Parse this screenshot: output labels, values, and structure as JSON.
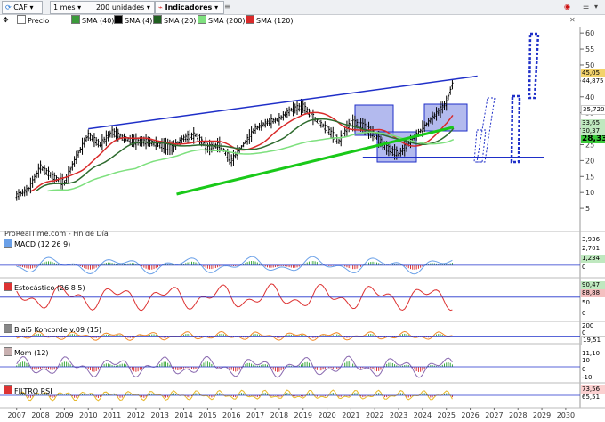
{
  "toolbar": {
    "symbol": "CAF",
    "interval": "1 mes",
    "units": "200 unidades",
    "indicators": "Indicadores"
  },
  "price_legend": [
    {
      "label": "Precio",
      "color": "#ffffff"
    },
    {
      "label": "SMA (40)",
      "color": "#3a9a3a"
    },
    {
      "label": "SMA (4)",
      "color": "#000000"
    },
    {
      "label": "SMA (20)",
      "color": "#1f5f1f"
    },
    {
      "label": "SMA (200)",
      "color": "#7ee07e"
    },
    {
      "label": "SMA (120)",
      "color": "#d92a2a"
    }
  ],
  "watermark": "ProRealTime.com - Fin de Día",
  "price_axis": {
    "ticks": [
      "60",
      "55",
      "50",
      "45",
      "40",
      "35",
      "30",
      "25",
      "20",
      "15",
      "10",
      "5"
    ]
  },
  "price_tags": [
    {
      "value": "45,05",
      "value2": "44,875",
      "color": "#f3d36b"
    },
    {
      "value": "35,720",
      "color": "#ffffff"
    },
    {
      "value": "33,65",
      "color": "#bfe8bf"
    },
    {
      "value": "30,37",
      "color": "#bfe8bf"
    },
    {
      "value": "28,33",
      "color": "#3ccc3c"
    }
  ],
  "x_axis": {
    "years": [
      "2007",
      "2008",
      "2009",
      "2010",
      "2011",
      "2012",
      "2013",
      "2014",
      "2015",
      "2016",
      "2017",
      "2018",
      "2019",
      "2020",
      "2021",
      "2022",
      "2023",
      "2024",
      "2025",
      "2026",
      "2027",
      "2028",
      "2029",
      "2030"
    ]
  },
  "panels": {
    "macd": {
      "title": "MACD (12 26 9)",
      "ticks": [
        "3,936",
        "2,701",
        "1,234",
        "0"
      ]
    },
    "stoch": {
      "title": "Estocástico (26 8 5)",
      "ticks": [
        "90,47",
        "88,88",
        "50",
        "0"
      ]
    },
    "blai": {
      "title": "Blai5 Koncorde v.09 (15)",
      "ticks": [
        "200",
        "0",
        "19,51"
      ]
    },
    "mom": {
      "title": "Mom (12)",
      "ticks": [
        "11,10",
        "10",
        "0",
        "-10"
      ]
    },
    "rsi": {
      "title": "FILTRO RSI",
      "ticks": [
        "73,56",
        "65,51"
      ]
    }
  },
  "colors": {
    "up_candle": "#000000",
    "trend_line": "#1f2fc8",
    "box_fill": "#9aa3e8",
    "sma_red": "#d92a2a",
    "sma_dark": "#2e6b2e",
    "sma_light": "#53d653",
    "zero_line": "#2233cc"
  },
  "chart_data": {
    "type": "line",
    "title": "CAF",
    "x": [
      2007.0,
      2007.5,
      2008.0,
      2008.5,
      2009.0,
      2009.5,
      2010.0,
      2010.5,
      2011.0,
      2011.5,
      2012.0,
      2012.5,
      2013.0,
      2013.5,
      2014.0,
      2014.5,
      2015.0,
      2015.5,
      2016.0,
      2016.5,
      2017.0,
      2017.5,
      2018.0,
      2018.5,
      2019.0,
      2019.5,
      2020.0,
      2020.5,
      2021.0,
      2021.5,
      2022.0,
      2022.5,
      2023.0,
      2023.5,
      2024.0,
      2024.5,
      2025.0,
      2025.3
    ],
    "series": [
      {
        "name": "Precio",
        "values": [
          9,
          11,
          18,
          15,
          13,
          21,
          28,
          25,
          29,
          27,
          26,
          26,
          25,
          24,
          27,
          28,
          24,
          25,
          20,
          25,
          30,
          32,
          33,
          36,
          37,
          33,
          30,
          26,
          32,
          31,
          28,
          24,
          22,
          26,
          30,
          34,
          38,
          45
        ]
      }
    ],
    "ylim": [
      0,
      62
    ],
    "xlim": [
      2006.6,
      2030.6
    ],
    "grid": false,
    "legend": "top-left"
  }
}
